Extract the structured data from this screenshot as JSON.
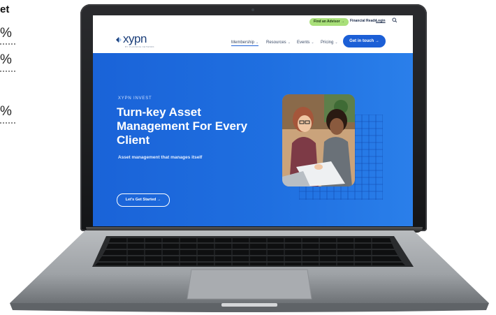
{
  "fragment": {
    "title": "et",
    "percents": [
      "%",
      "%",
      "%"
    ]
  },
  "site": {
    "topbar": {
      "advisor_button": "Find an Advisor →",
      "financial_reads": "Financial Reads",
      "login": "Login"
    },
    "logo": {
      "wordmark": "xypn",
      "tagline": "BY PLANNING NETWORK"
    },
    "nav": {
      "items": [
        {
          "label": "Membership"
        },
        {
          "label": "Resources"
        },
        {
          "label": "Events"
        },
        {
          "label": "Pricing"
        }
      ],
      "cta": "Get in touch →"
    },
    "hero": {
      "eyebrow": "XYPN INVEST",
      "headline": "Turn-key Asset Management For Every Client",
      "subhead": "Asset management that manages itself",
      "button": "Let's Get Started →"
    }
  },
  "colors": {
    "hero_blue": "#1f6fe0",
    "brand_navy": "#1c3f7a",
    "accent_green": "#a9e07a"
  }
}
